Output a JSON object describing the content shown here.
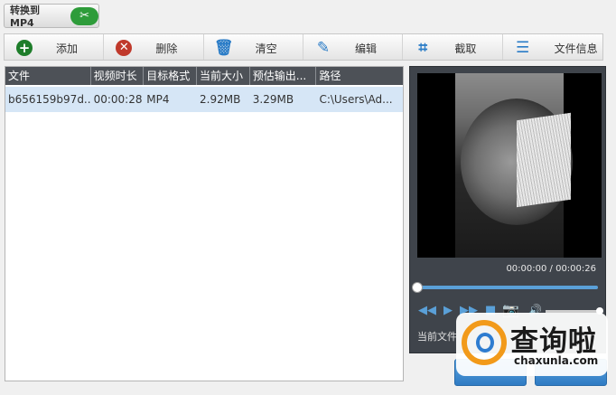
{
  "convert": {
    "label": "转换到 MP4",
    "icon": "tools-icon"
  },
  "toolbar": {
    "add": "添加",
    "delete": "删除",
    "clear": "清空",
    "edit": "编辑",
    "crop": "截取",
    "info": "文件信息"
  },
  "list": {
    "columns": [
      "文件",
      "视频时长",
      "目标格式",
      "当前大小",
      "预估输出...",
      "路径"
    ],
    "rows": [
      [
        "b656159b97d...",
        "00:00:28",
        "MP4",
        "2.92MB",
        "3.29MB",
        "C:\\Users\\Ad..."
      ]
    ]
  },
  "preview": {
    "time": "00:00:00 / 00:00:26",
    "current_file_label": "当前文件",
    "progress": 0.0,
    "volume": 1.0
  },
  "watermark": {
    "title": "查询啦",
    "url": "chaxunla.com"
  }
}
